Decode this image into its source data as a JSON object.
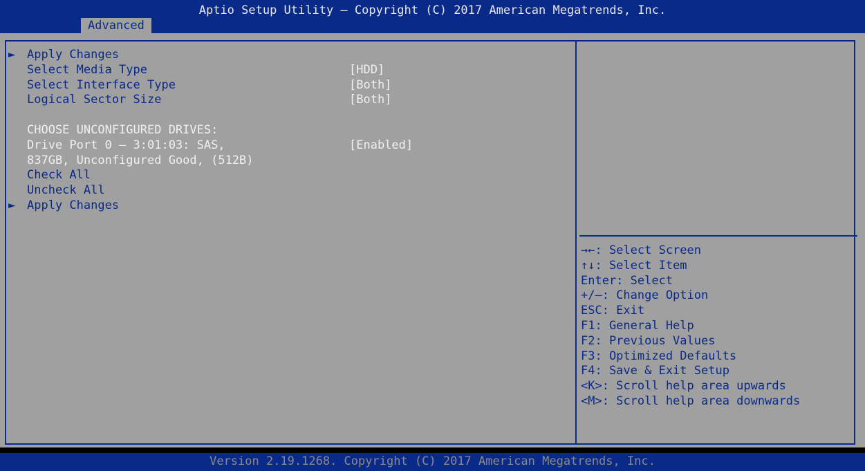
{
  "header": {
    "title": "Aptio Setup Utility – Copyright (C) 2017 American Megatrends, Inc.",
    "active_tab": "Advanced"
  },
  "main": {
    "items": [
      {
        "label": "Apply Changes",
        "submenu": true,
        "value": ""
      },
      {
        "label": "Select Media Type",
        "submenu": false,
        "value": "[HDD]"
      },
      {
        "label": "Select Interface Type",
        "submenu": false,
        "value": "[Both]"
      },
      {
        "label": "Logical Sector Size",
        "submenu": false,
        "value": "[Both]"
      },
      {
        "label": "",
        "submenu": false,
        "value": ""
      },
      {
        "label": "CHOOSE UNCONFIGURED DRIVES:",
        "submenu": false,
        "value": ""
      },
      {
        "label": "Drive Port 0 – 3:01:03: SAS,",
        "submenu": false,
        "value": "[Enabled]"
      },
      {
        "label": "837GB, Unconfigured Good, (512B)",
        "submenu": false,
        "value": ""
      },
      {
        "label": "Check All",
        "submenu": false,
        "value": ""
      },
      {
        "label": "Uncheck All",
        "submenu": false,
        "value": ""
      },
      {
        "label": "Apply Changes",
        "submenu": true,
        "value": ""
      }
    ],
    "submenu_arrow": "►"
  },
  "help": {
    "keys": [
      "→←: Select Screen",
      "↑↓: Select Item",
      "Enter: Select",
      "+/–: Change Option",
      "ESC: Exit",
      "F1: General Help",
      "F2: Previous Values",
      "F3: Optimized Defaults",
      "F4: Save & Exit Setup",
      "<K>: Scroll help area upwards",
      "<M>: Scroll help area downwards"
    ]
  },
  "footer": {
    "version": "Version 2.19.1268. Copyright (C) 2017 American Megatrends, Inc."
  },
  "colors": {
    "bar_blue": "#0a2a8a",
    "panel_gray": "#a0a0a0",
    "highlight_white": "#f0f0f0"
  }
}
